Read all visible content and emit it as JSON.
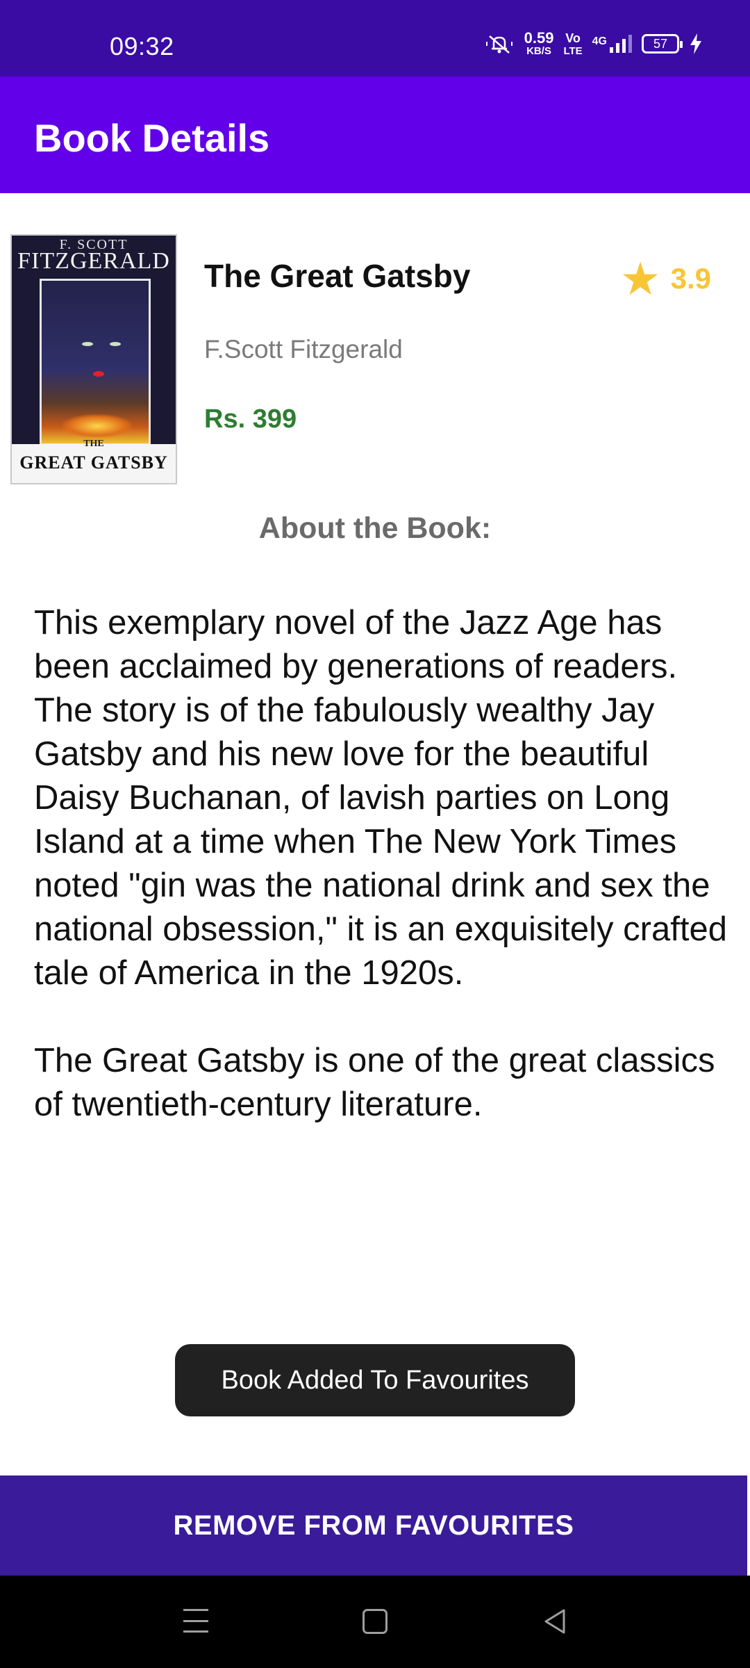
{
  "status_bar": {
    "time": "09:32",
    "net_speed_value": "0.59",
    "net_speed_unit": "KB/S",
    "volte_top": "Vo",
    "volte_bottom": "LTE",
    "network_type": "4G",
    "battery_level": "57",
    "icons": [
      "mute-bell-icon",
      "signal-icon",
      "battery-icon",
      "charging-bolt-icon"
    ]
  },
  "app_bar": {
    "title": "Book Details"
  },
  "book": {
    "cover": {
      "author_small": "F. SCOTT",
      "author": "FITZGERALD",
      "the": "THE",
      "title": "GREAT GATSBY"
    },
    "title": "The Great Gatsby",
    "author": "F.Scott Fitzgerald",
    "price": "Rs. 399",
    "rating": "3.9",
    "rating_icon": "star-icon"
  },
  "about": {
    "heading": "About the Book:",
    "body": "This exemplary novel of the Jazz Age has been acclaimed by generations of readers. The story is of the fabulously wealthy Jay Gatsby and his new love for the beautiful Daisy Buchanan, of lavish parties on Long Island at a time when The New York Times noted \"gin was the national drink and sex the national obsession,\" it is an exquisitely crafted tale of America in the 1920s.\n\nThe Great Gatsby is one of the great classics of twentieth-century literature."
  },
  "toast": {
    "message": "Book Added To Favourites"
  },
  "action": {
    "label": "REMOVE FROM FAVOURITES"
  },
  "nav": {
    "icons": [
      "menu-icon",
      "home-icon",
      "back-icon"
    ]
  },
  "colors": {
    "status_bar": "#3a0ca3",
    "app_bar": "#6200ea",
    "rating": "#f8c537",
    "price": "#2e7d32",
    "button": "#3a1b9a"
  }
}
